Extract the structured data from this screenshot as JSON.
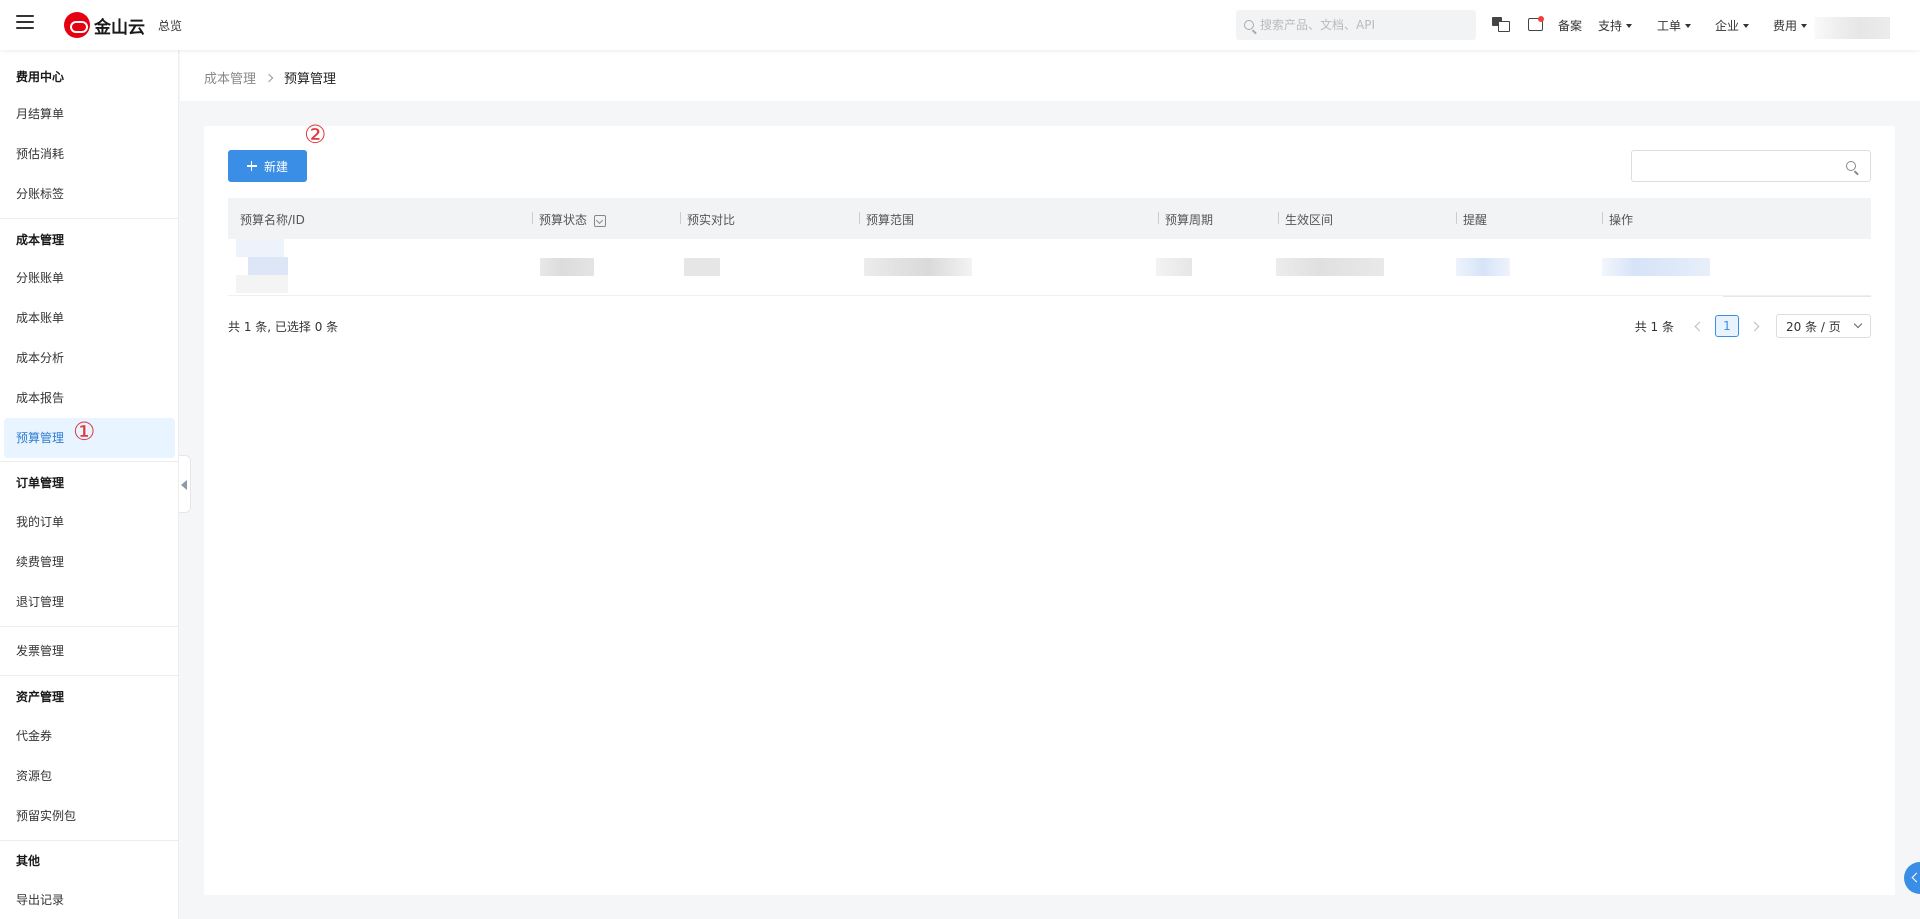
{
  "header": {
    "logo_text": "金山云",
    "overview": "总览",
    "search_placeholder": "搜索产品、文档、API",
    "nav": {
      "filing": "备案",
      "support": "支持",
      "ticket": "工单",
      "enterprise": "企业",
      "billing": "费用"
    }
  },
  "sidebar": {
    "groups": {
      "billing_center": "费用中心",
      "cost_management": "成本管理",
      "order_management": "订单管理",
      "asset_management": "资产管理",
      "other": "其他"
    },
    "items": {
      "monthly_bill": "月结算单",
      "estimated_consumption": "预估消耗",
      "split_tag": "分账标签",
      "split_bill": "分账账单",
      "cost_bill": "成本账单",
      "cost_analysis": "成本分析",
      "cost_report": "成本报告",
      "budget_management": "预算管理",
      "my_orders": "我的订单",
      "renewal_management": "续费管理",
      "unsubscribe_management": "退订管理",
      "invoice_management": "发票管理",
      "voucher": "代金券",
      "resource_package": "资源包",
      "reserved_instance": "预留实例包",
      "export_records": "导出记录"
    },
    "active_item": "budget_management"
  },
  "annotations": {
    "marker_1": "①",
    "marker_2": "②"
  },
  "breadcrumb": {
    "parent": "成本管理",
    "current": "预算管理"
  },
  "toolbar": {
    "new_label": "新建",
    "search_value": ""
  },
  "table": {
    "columns": {
      "name_id": "预算名称/ID",
      "status": "预算状态",
      "actual_vs": "预实对比",
      "scope": "预算范围",
      "period": "预算周期",
      "effective_range": "生效区间",
      "reminder": "提醒",
      "actions": "操作"
    }
  },
  "footer": {
    "summary": "共 1 条, 已选择 0 条",
    "pager_total": "共 1 条",
    "current_page": "1",
    "page_size": "20 条 / 页"
  },
  "colors": {
    "primary": "#3a8ee6",
    "active_bg": "#e8f4ff",
    "active_text": "#2f7bd1",
    "annotation": "#e0383c",
    "brand": "#e60012"
  }
}
